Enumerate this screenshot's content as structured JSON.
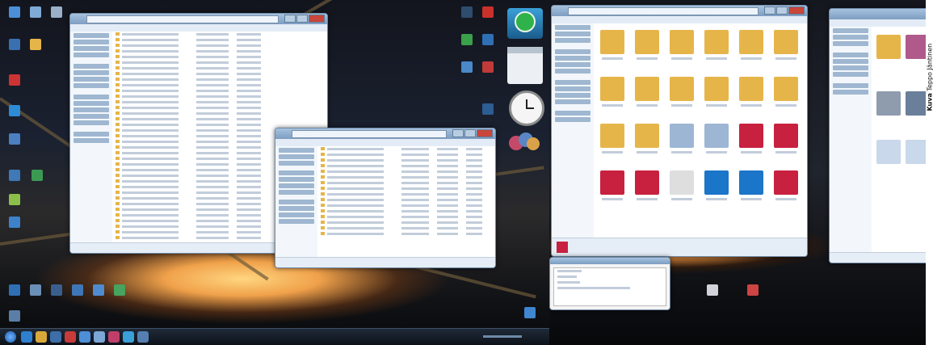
{
  "watermark": {
    "label": "Kuva",
    "author": "Teppo Jäntinen"
  },
  "colors": {
    "folder": "#e6b54a",
    "indesign": "#c8203f",
    "photoshop": "#1b75c8",
    "taskbar": "#15202d",
    "window_frame": "#a6c2df"
  },
  "left_screen": {
    "desktop_icon_names": [
      "network-icon",
      "computer-icon",
      "recycle-bin-icon",
      "app-icon",
      "folder-icon",
      "media-icon",
      "browser-icon",
      "document-icon"
    ],
    "gadgets": [
      "checkmark-gadget",
      "calendar-gadget",
      "clock-gadget",
      "photo-gadget"
    ]
  },
  "right_screen": {
    "file_tiles": [
      "folder",
      "folder",
      "folder",
      "folder",
      "folder",
      "folder",
      "folder",
      "folder",
      "folder",
      "folder",
      "folder",
      "folder",
      "folder",
      "folder",
      "image",
      "image",
      "indesign",
      "indesign",
      "indesign",
      "indesign",
      "document",
      "photoshop",
      "photoshop",
      "indesign"
    ]
  }
}
